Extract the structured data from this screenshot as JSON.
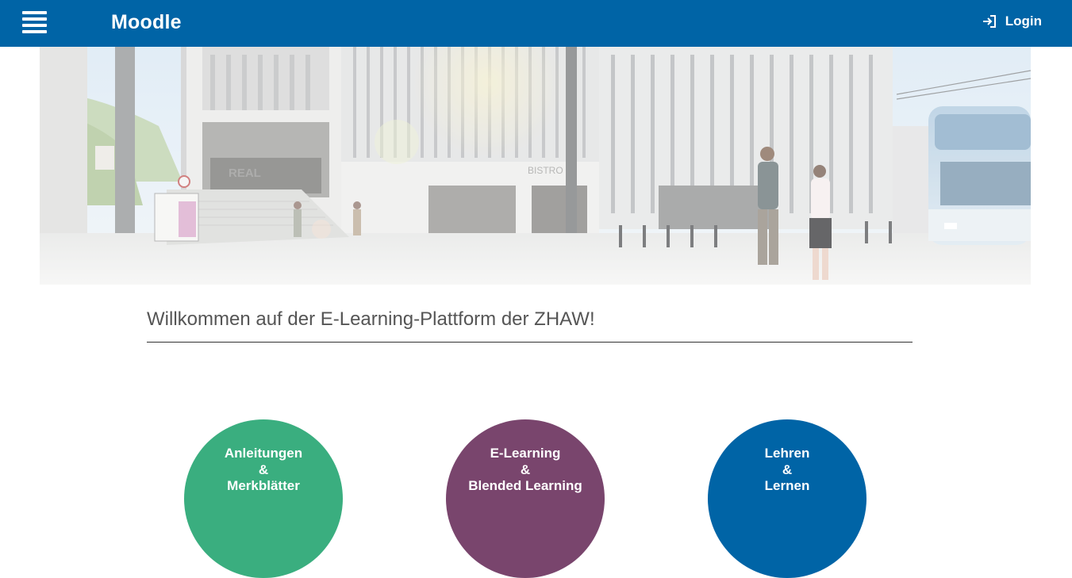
{
  "navbar": {
    "brand": "Moodle",
    "login_label": "Login",
    "menu_icon": "hamburger-menu-icon",
    "login_icon": "login-arrow-icon",
    "color": "#0064a6"
  },
  "hero": {
    "signs": {
      "bistro": "BISTRO",
      "real": "REAL"
    }
  },
  "main": {
    "welcome": "Willkommen auf der E-Learning-Plattform der ZHAW!"
  },
  "tiles": [
    {
      "line1": "Anleitungen",
      "line2": "&",
      "line3": "Merkblätter",
      "color": "#3aae7f"
    },
    {
      "line1": "E-Learning",
      "line2": "&",
      "line3": "Blended Learning",
      "color": "#79456d"
    },
    {
      "line1": "Lehren",
      "line2": "&",
      "line3": "Lernen",
      "color": "#0064a6"
    }
  ]
}
